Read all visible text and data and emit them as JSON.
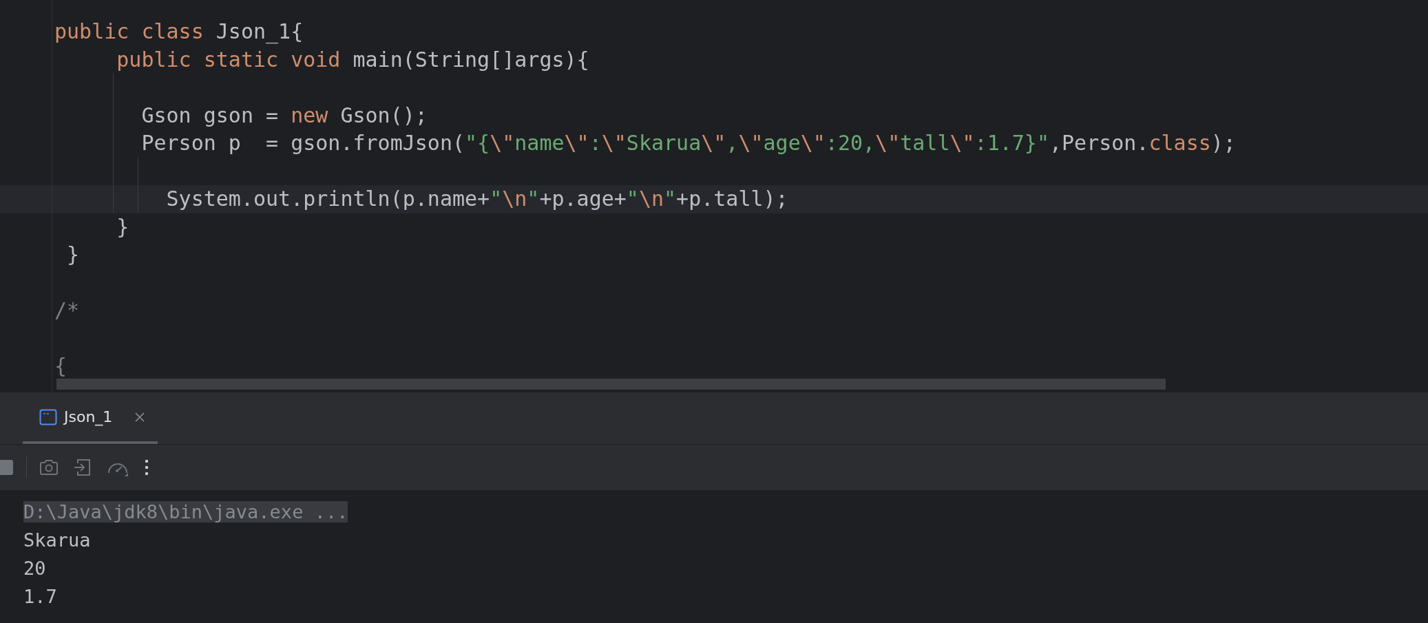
{
  "editor": {
    "lines": [
      {
        "kind": "code",
        "current": false,
        "tokens": [
          {
            "kind": "keyword",
            "text": "public class "
          },
          {
            "kind": "plain",
            "text": "Json_1{"
          }
        ]
      },
      {
        "kind": "code",
        "current": false,
        "tokens": [
          {
            "kind": "keyword",
            "text": "     public static void "
          },
          {
            "kind": "plain",
            "text": "main(String[]args){"
          }
        ]
      },
      {
        "kind": "blank",
        "current": false
      },
      {
        "kind": "code",
        "current": false,
        "tokens": [
          {
            "kind": "plain",
            "text": "       Gson gson = "
          },
          {
            "kind": "keyword",
            "text": "new"
          },
          {
            "kind": "plain",
            "text": " Gson();"
          }
        ]
      },
      {
        "kind": "code",
        "current": false,
        "tokens": [
          {
            "kind": "plain",
            "text": "       Person p  = gson.fromJson("
          },
          {
            "kind": "string",
            "text": "\"{"
          },
          {
            "kind": "escape",
            "text": "\\\""
          },
          {
            "kind": "string",
            "text": "name"
          },
          {
            "kind": "escape",
            "text": "\\\""
          },
          {
            "kind": "string",
            "text": ":"
          },
          {
            "kind": "escape",
            "text": "\\\""
          },
          {
            "kind": "string",
            "text": "Skarua"
          },
          {
            "kind": "escape",
            "text": "\\\""
          },
          {
            "kind": "string",
            "text": ","
          },
          {
            "kind": "escape",
            "text": "\\\""
          },
          {
            "kind": "string",
            "text": "age"
          },
          {
            "kind": "escape",
            "text": "\\\""
          },
          {
            "kind": "string",
            "text": ":20,"
          },
          {
            "kind": "escape",
            "text": "\\\""
          },
          {
            "kind": "string",
            "text": "tall"
          },
          {
            "kind": "escape",
            "text": "\\\""
          },
          {
            "kind": "string",
            "text": ":1.7}\""
          },
          {
            "kind": "plain",
            "text": ",Person."
          },
          {
            "kind": "keyword",
            "text": "class"
          },
          {
            "kind": "plain",
            "text": ");"
          }
        ]
      },
      {
        "kind": "blank",
        "current": false
      },
      {
        "kind": "code",
        "current": true,
        "tokens": [
          {
            "kind": "plain",
            "text": "         System.out.println(p.name+"
          },
          {
            "kind": "string",
            "text": "\""
          },
          {
            "kind": "escape",
            "text": "\\n"
          },
          {
            "kind": "string",
            "text": "\""
          },
          {
            "kind": "plain",
            "text": "+p.age+"
          },
          {
            "kind": "string",
            "text": "\""
          },
          {
            "kind": "escape",
            "text": "\\n"
          },
          {
            "kind": "string",
            "text": "\""
          },
          {
            "kind": "plain",
            "text": "+p.tall);"
          }
        ]
      },
      {
        "kind": "code",
        "current": false,
        "tokens": [
          {
            "kind": "plain",
            "text": "     }"
          }
        ]
      },
      {
        "kind": "code",
        "current": false,
        "tokens": [
          {
            "kind": "plain",
            "text": " }"
          }
        ]
      },
      {
        "kind": "blank",
        "current": false
      },
      {
        "kind": "code",
        "current": false,
        "tokens": [
          {
            "kind": "comment",
            "text": "/*"
          }
        ]
      },
      {
        "kind": "blank",
        "current": false
      },
      {
        "kind": "code",
        "current": false,
        "tokens": [
          {
            "kind": "comment",
            "text": "{"
          }
        ]
      }
    ]
  },
  "run_panel": {
    "tabs": [
      {
        "label": "Json_1",
        "selected": true
      }
    ],
    "console": [
      {
        "kind": "command",
        "text": "D:\\Java\\jdk8\\bin\\java.exe ..."
      },
      {
        "kind": "output",
        "text": "Skarua"
      },
      {
        "kind": "output",
        "text": "20"
      },
      {
        "kind": "output",
        "text": "1.7"
      }
    ]
  }
}
